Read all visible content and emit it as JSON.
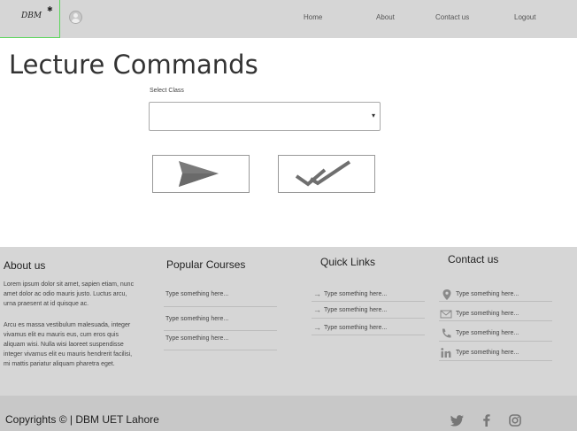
{
  "header": {
    "logo": "DBM",
    "nav": [
      "Home",
      "About",
      "Contact us",
      "Logout"
    ]
  },
  "main": {
    "title": "Lecture Commands",
    "select_label": "Select Class",
    "select_value": ""
  },
  "footer": {
    "about": {
      "heading": "About us",
      "para1": "Lorem ipsum dolor sit amet, sapien etiam, nunc amet dolor ac odio mauris justo. Luctus arcu, urna praesent at id quisque ac.",
      "para2": "Arcu es massa vestibulum malesuada, integer vivamus elit eu mauris eus, cum eros quis aliquam wisi. Nulla wisi laoreet suspendisse integer vivamus elit eu mauris hendrerit facilisi, mi mattis pariatur aliquam pharetra eget."
    },
    "courses": {
      "heading": "Popular Courses",
      "items": [
        "Type something here...",
        "Type something here...",
        "Type something here..."
      ]
    },
    "links": {
      "heading": "Quick Links",
      "items": [
        "Type something here...",
        "Type something here...",
        "Type something here..."
      ]
    },
    "contact": {
      "heading": "Contact us",
      "items": [
        "Type something here...",
        "Type something here...",
        "Type something here...",
        "Type something here..."
      ]
    }
  },
  "bottom": {
    "copyright": "Copyrights © | DBM UET Lahore"
  },
  "colors": {
    "header_bg": "#d6d6d6",
    "footer_bg": "#d6d6d6",
    "logo_border": "#5bd65b",
    "icon": "#7a7a7a"
  }
}
